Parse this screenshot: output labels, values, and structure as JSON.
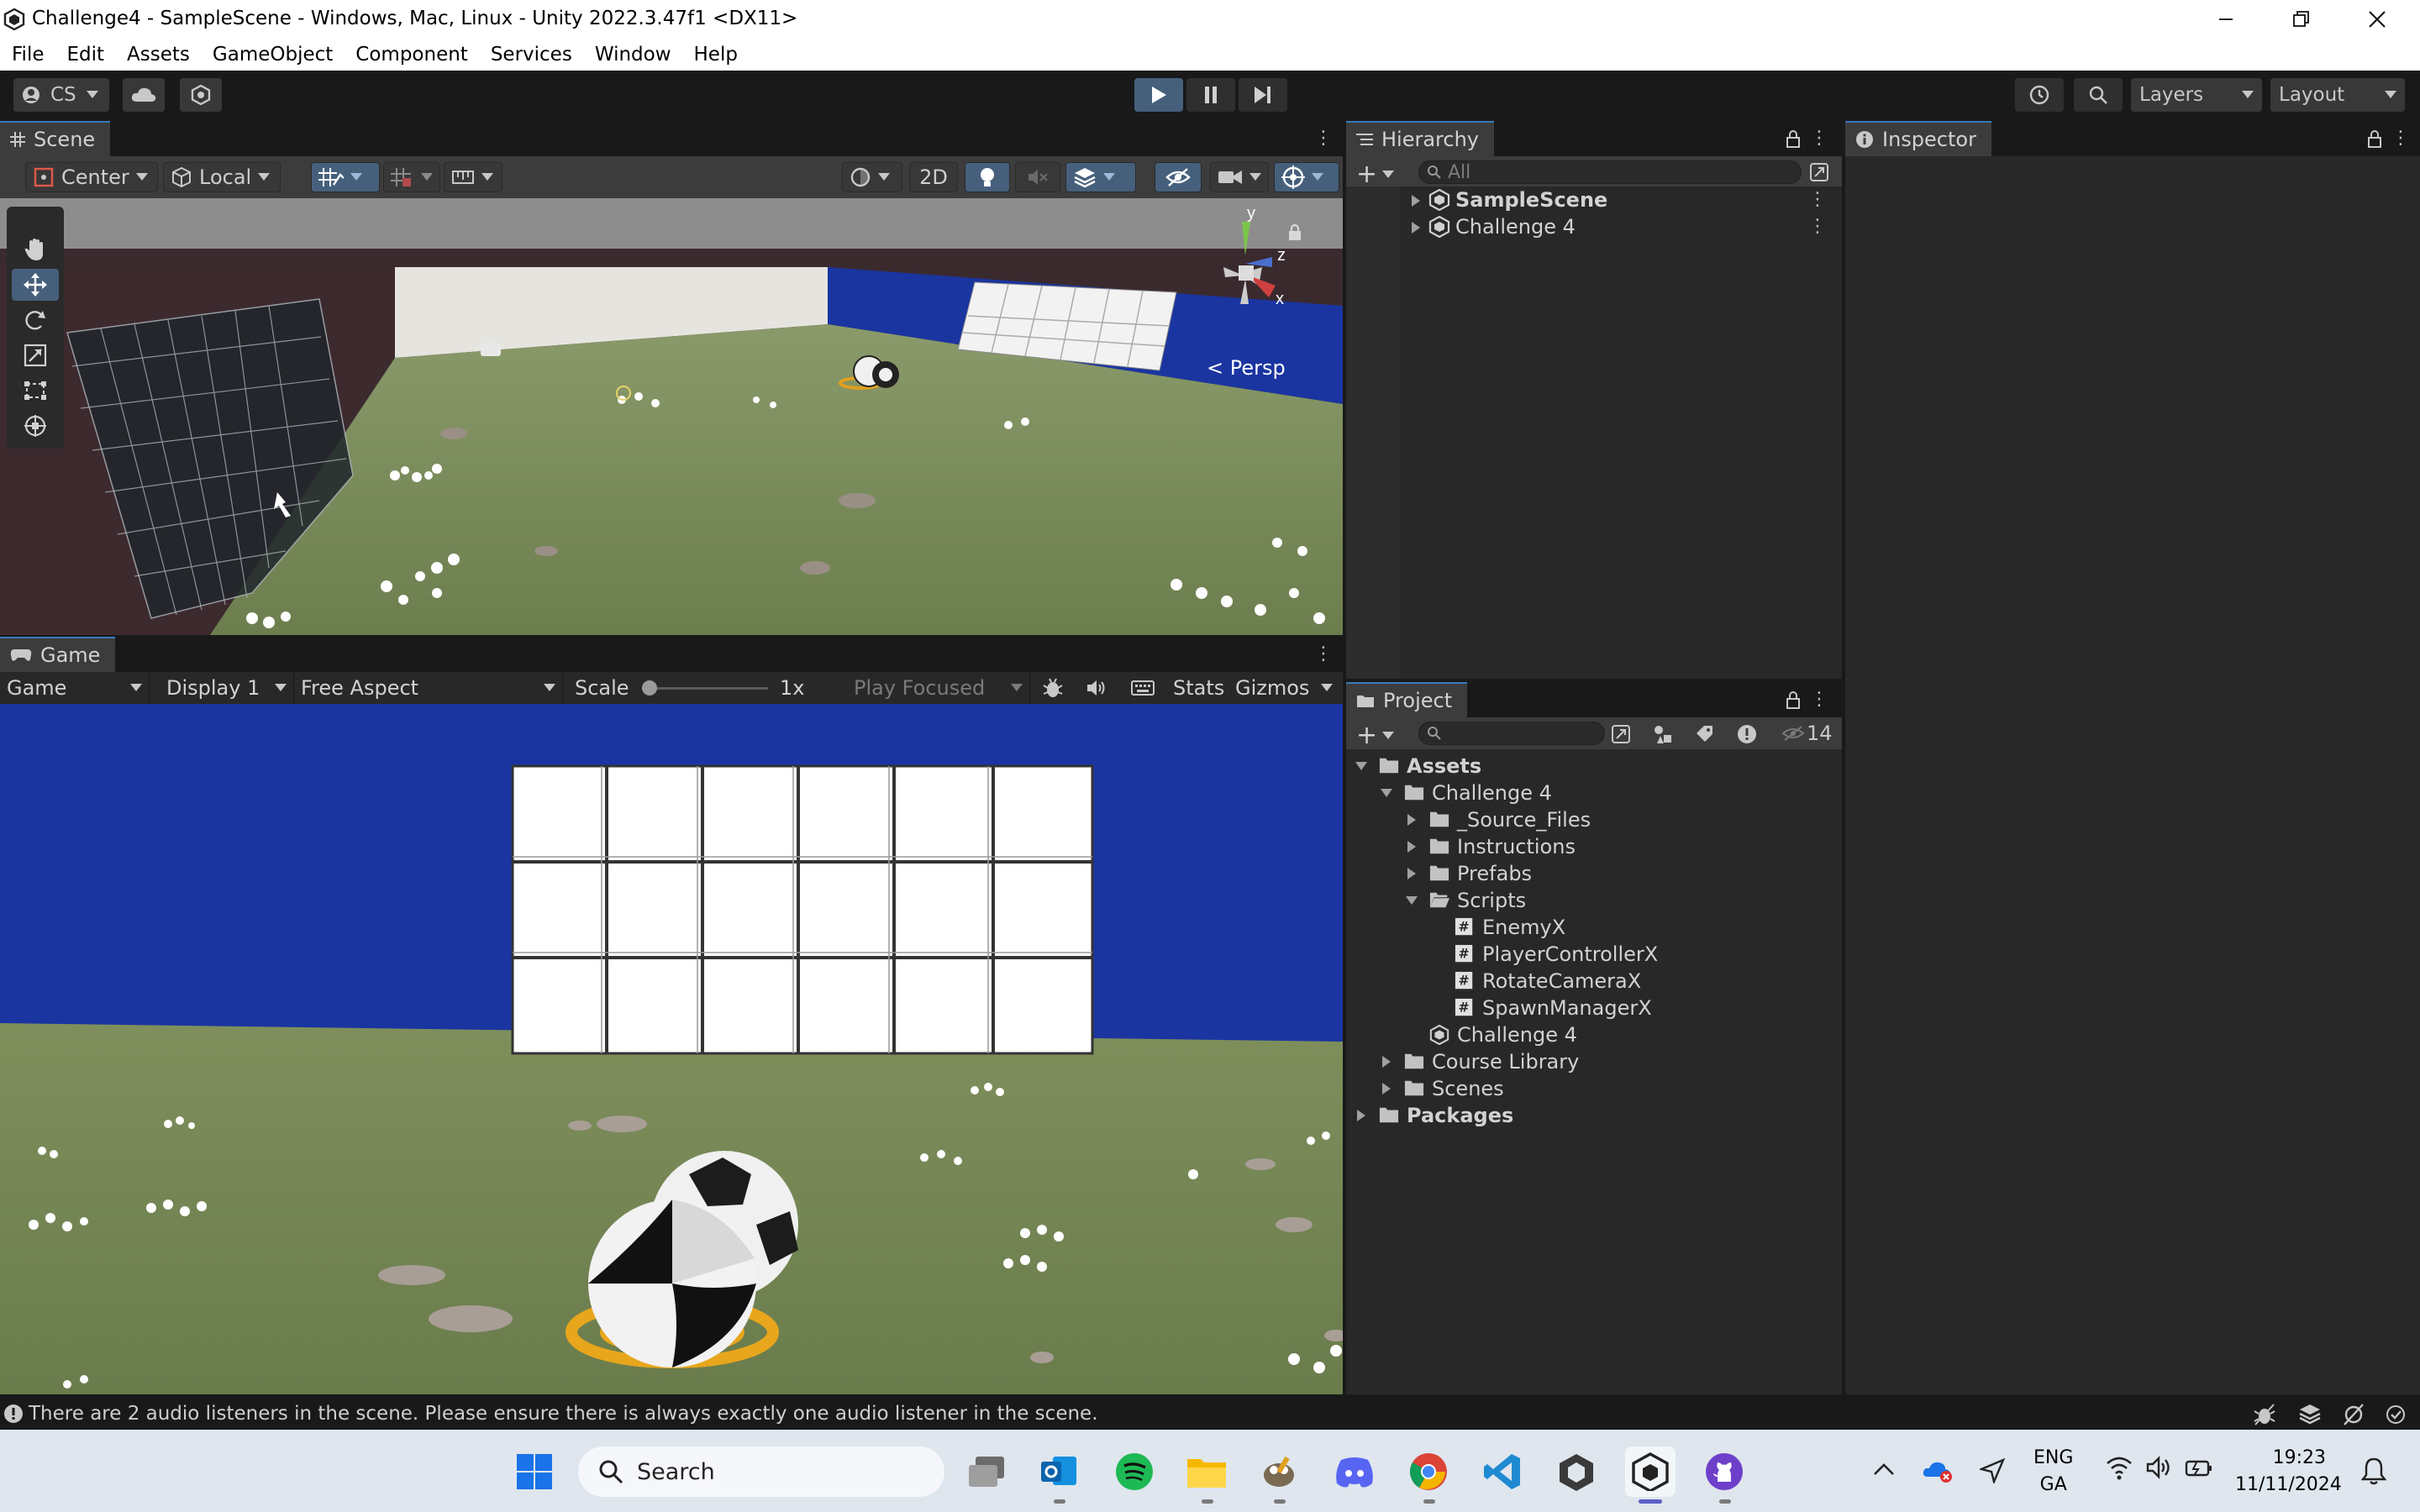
{
  "window": {
    "title": "Challenge4 - SampleScene - Windows, Mac, Linux - Unity 2022.3.47f1 <DX11>"
  },
  "menu": [
    "File",
    "Edit",
    "Assets",
    "GameObject",
    "Component",
    "Services",
    "Window",
    "Help"
  ],
  "toolbar": {
    "account_label": "CS",
    "layers_label": "Layers",
    "layout_label": "Layout"
  },
  "scene": {
    "tab_label": "Scene",
    "pivot_label": "Center",
    "space_label": "Local",
    "mode_2d_label": "2D",
    "persp_label": "Persp",
    "gizmo_axes": [
      "y",
      "z",
      "x"
    ]
  },
  "game": {
    "tab_label": "Game",
    "view_dropdown": "Game",
    "display_dropdown": "Display 1",
    "aspect_dropdown": "Free Aspect",
    "scale_label": "Scale",
    "scale_value": "1x",
    "scale_slider_fraction": 0.0,
    "play_mode_dropdown": "Play Focused",
    "stats_label": "Stats",
    "gizmos_label": "Gizmos"
  },
  "hierarchy": {
    "tab_label": "Hierarchy",
    "search_placeholder": "All",
    "items": [
      {
        "label": "SampleScene"
      },
      {
        "label": "Challenge 4"
      }
    ]
  },
  "project": {
    "tab_label": "Project",
    "hidden_count": "14",
    "tree": [
      {
        "label": "Assets"
      },
      {
        "label": "Challenge 4"
      },
      {
        "label": "_Source_Files"
      },
      {
        "label": "Instructions"
      },
      {
        "label": "Prefabs"
      },
      {
        "label": "Scripts"
      },
      {
        "label": "EnemyX"
      },
      {
        "label": "PlayerControllerX"
      },
      {
        "label": "RotateCameraX"
      },
      {
        "label": "SpawnManagerX"
      },
      {
        "label": "Challenge 4"
      },
      {
        "label": "Course Library"
      },
      {
        "label": "Scenes"
      },
      {
        "label": "Packages"
      }
    ]
  },
  "inspector": {
    "tab_label": "Inspector"
  },
  "status": {
    "message": "There are 2 audio listeners in the scene. Please ensure there is always exactly one audio listener in the scene."
  },
  "taskbar": {
    "search_label": "Search",
    "lang_top": "ENG",
    "lang_bottom": "GA",
    "time": "19:23",
    "date": "11/11/2024"
  },
  "colors": {
    "editor_bg": "#191919",
    "panel_bg": "#282828",
    "accent_blue": "#46607c",
    "grass": "#6e7a55",
    "wall_blue": "#1a35a0"
  }
}
